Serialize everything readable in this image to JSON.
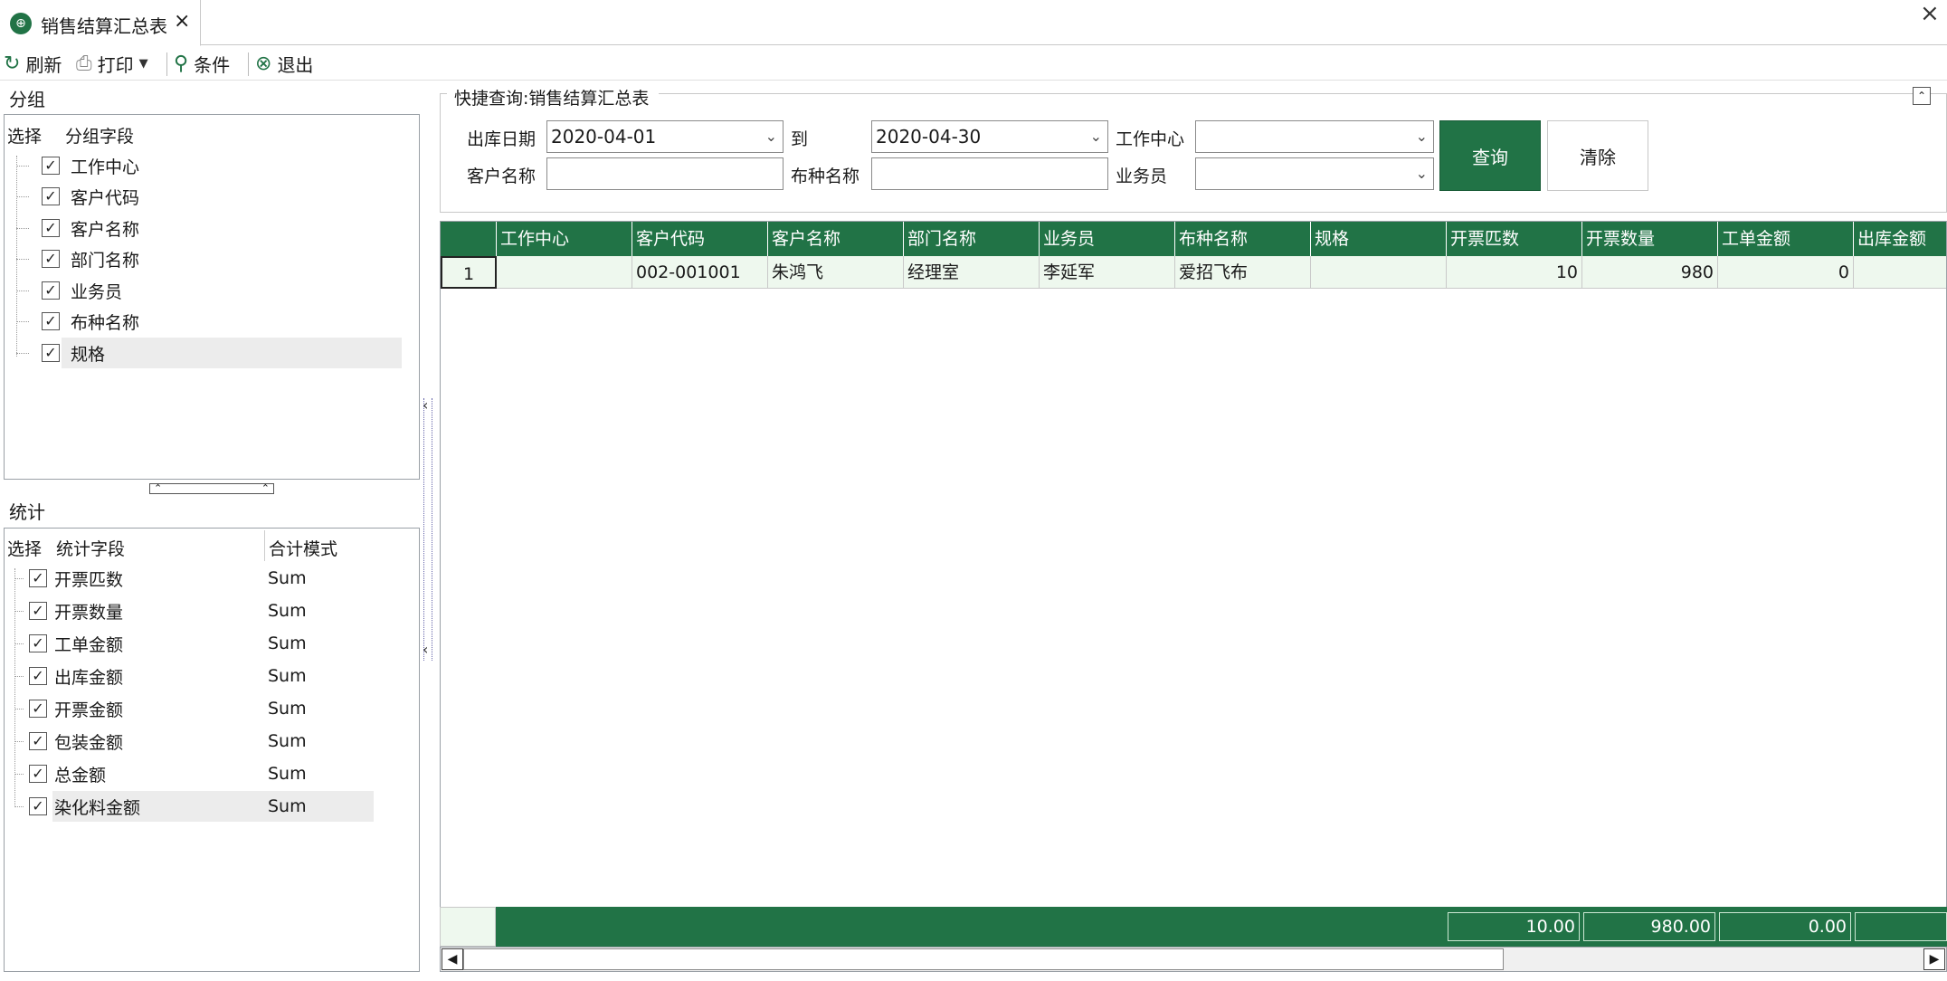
{
  "tab": {
    "title": "销售结算汇总表",
    "close": "×"
  },
  "window": {
    "close": "×"
  },
  "toolbar": {
    "refresh": "刷新",
    "print": "打印",
    "condition": "条件",
    "exit": "退出"
  },
  "group": {
    "section_title": "分组",
    "col_select": "选择",
    "col_field": "分组字段",
    "items": [
      {
        "label": "工作中心",
        "checked": true
      },
      {
        "label": "客户代码",
        "checked": true
      },
      {
        "label": "客户名称",
        "checked": true
      },
      {
        "label": "部门名称",
        "checked": true
      },
      {
        "label": "业务员",
        "checked": true
      },
      {
        "label": "布种名称",
        "checked": true
      },
      {
        "label": "规格",
        "checked": true
      }
    ]
  },
  "stats": {
    "section_title": "统计",
    "col_select": "选择",
    "col_field": "统计字段",
    "col_mode": "合计模式",
    "items": [
      {
        "label": "开票匹数",
        "mode": "Sum",
        "checked": true
      },
      {
        "label": "开票数量",
        "mode": "Sum",
        "checked": true
      },
      {
        "label": "工单金额",
        "mode": "Sum",
        "checked": true
      },
      {
        "label": "出库金额",
        "mode": "Sum",
        "checked": true
      },
      {
        "label": "开票金额",
        "mode": "Sum",
        "checked": true
      },
      {
        "label": "包装金额",
        "mode": "Sum",
        "checked": true
      },
      {
        "label": "总金额",
        "mode": "Sum",
        "checked": true
      },
      {
        "label": "染化料金额",
        "mode": "Sum",
        "checked": true
      }
    ]
  },
  "query": {
    "title": "快捷查询:销售结算汇总表",
    "date_label": "出库日期",
    "date_from": "2020-04-01",
    "to_label": "到",
    "date_to": "2020-04-30",
    "workcenter_label": "工作中心",
    "workcenter_value": "",
    "customer_label": "客户名称",
    "customer_value": "",
    "fabric_label": "布种名称",
    "fabric_value": "",
    "salesman_label": "业务员",
    "salesman_value": "",
    "query_button": "查询",
    "clear_button": "清除"
  },
  "grid": {
    "columns": [
      "工作中心",
      "客户代码",
      "客户名称",
      "部门名称",
      "业务员",
      "布种名称",
      "规格",
      "开票匹数",
      "开票数量",
      "工单金额",
      "出库金额"
    ],
    "rows": [
      {
        "num": "1",
        "cells": [
          "",
          "002-001001",
          "朱鸿飞",
          "经理室",
          "李延军",
          "爱招飞布",
          "",
          "10",
          "980",
          "0",
          ""
        ]
      }
    ],
    "footer": [
      "10.00",
      "980.00",
      "0.00",
      ""
    ]
  },
  "colors": {
    "accent": "#217346",
    "row_bg": "#eef8ee"
  }
}
